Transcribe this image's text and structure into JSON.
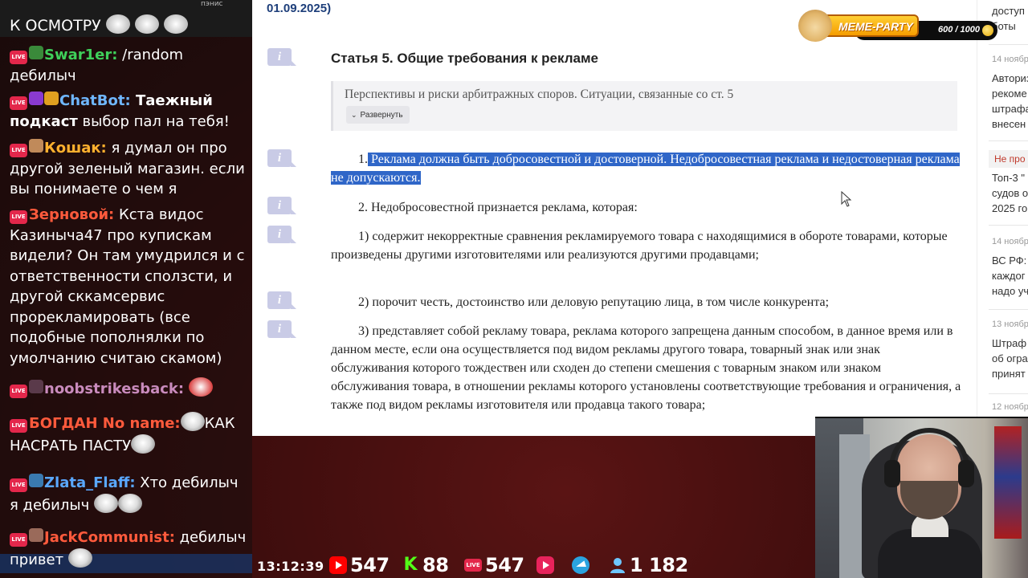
{
  "chat": {
    "top_name": "пэнис",
    "first_line": "К ОСМОТРУ",
    "messages": [
      {
        "nick": "Swar1er:",
        "nick_color": "#3fcf5a",
        "text": " /random дебилыч"
      },
      {
        "nick": "ChatBot:",
        "nick_color": "#6fb7ff",
        "bold_text": " Таежный подкаст",
        "text": " выбор пал на тебя!"
      },
      {
        "nick": "Кошак:",
        "nick_color": "#ffb02e",
        "text": " я думал он про другой зеленый магазин. если вы понимаете о чем я"
      },
      {
        "nick": "Зерновой:",
        "nick_color": "#ff5a3c",
        "text": " Кста видос Казиныча47 про купискам видели? Он там умудрился и с ответственности сползсти, и другой сккамсервис прорекламировать (все подобные пополнялки по умолчанию считаю скамом)"
      },
      {
        "nick": "noobstrikesback:",
        "nick_color": "#c98bbd",
        "text": ""
      },
      {
        "nick": "БОГДАН No name:",
        "nick_color": "#ff5a3c",
        "text": "КАК НАСРАТЬ ПАСТУ"
      },
      {
        "nick": "Zlata_Flaff:",
        "nick_color": "#5aa8ff",
        "text": " Хто дебилыч я дебилыч"
      },
      {
        "nick": "JackCommunist:",
        "nick_color": "#ff5a3c",
        "text": " дебилыч привет"
      }
    ],
    "live_badge": "LIVE"
  },
  "article": {
    "date_head": "01.09.2025)",
    "info_icon": "i",
    "title": "Статья 5. Общие требования к рекламе",
    "collapse_text": "Перспективы и риски арбитражных споров. Ситуации, связанные со ст. 5",
    "expand_label": "Развернуть",
    "p1_num": "1.",
    "p1_text": " Реклама должна быть добросовестной и достоверной. Недобросовестная реклама и недостоверная реклама не допускаются.",
    "p2": "2. Недобросовестной признается реклама, которая:",
    "p3": "1) содержит некорректные сравнения рекламируемого товара с находящимися в обороте товарами, которые произведены другими изготовителями или реализуются другими продавцами;",
    "p4": "2) порочит честь, достоинство или деловую репутацию лица, в том числе конкурента;",
    "p5": "3) представляет собой рекламу товара, реклама которого запрещена данным способом, в данное время или в данном месте, если она осуществляется под видом рекламы другого товара, товарный знак или знак обслуживания которого тождествен или сходен до степени смешения с товарным знаком или знаком обслуживания товара, в отношении рекламы которого установлены соответствующие требования и ограничения, а также под видом рекламы изготовителя или продавца такого товара;"
  },
  "meme_widget": {
    "title": "MEME-PARTY",
    "count": "600 / 1000"
  },
  "news": {
    "items": [
      {
        "date": "",
        "lines": [
          "доступ",
          "боты"
        ]
      },
      {
        "date": "14 ноябр",
        "lines": [
          "Авториз",
          "рекоме",
          "штрафа",
          "внесен"
        ]
      },
      {
        "date": "",
        "lines": [
          "Топ-3 \"",
          "судов о",
          "2025 го"
        ]
      },
      {
        "date": "14 ноябр",
        "lines": [
          "ВС РФ: ",
          "каждог",
          "надо уч"
        ]
      },
      {
        "date": "13 ноябр",
        "lines": [
          "Штраф",
          "об огра",
          "принят"
        ]
      },
      {
        "date": "12 ноябр",
        "lines": []
      }
    ],
    "ne_pro": "Не про"
  },
  "stats": {
    "clock": "13:12:39",
    "youtube": "547",
    "kick": "88",
    "vk": "547",
    "viewers": "1 182",
    "kick_icon": "K",
    "vk_icon": "LIVE"
  },
  "colors": {
    "highlight": "#2f66c8",
    "link_date": "#1d3e7a",
    "background_red": "#3a0c0c"
  }
}
